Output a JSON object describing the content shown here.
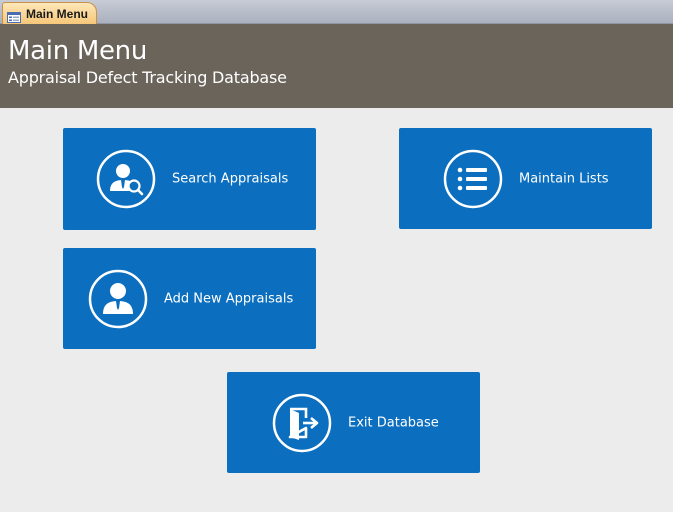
{
  "tab": {
    "label": "Main Menu",
    "icon": "form-icon"
  },
  "header": {
    "title": "Main Menu",
    "subtitle": "Appraisal Defect Tracking Database"
  },
  "tiles": {
    "search": {
      "label": "Search Appraisals",
      "icon": "person-search-icon"
    },
    "maintain": {
      "label": "Maintain Lists",
      "icon": "list-icon"
    },
    "add": {
      "label": "Add New Appraisals",
      "icon": "person-icon"
    },
    "exit": {
      "label": "Exit Database",
      "icon": "exit-door-icon"
    }
  },
  "colors": {
    "tile": "#0b6ebe",
    "header": "#6b645b",
    "background": "#ececec",
    "tab": "#f7c77a"
  }
}
